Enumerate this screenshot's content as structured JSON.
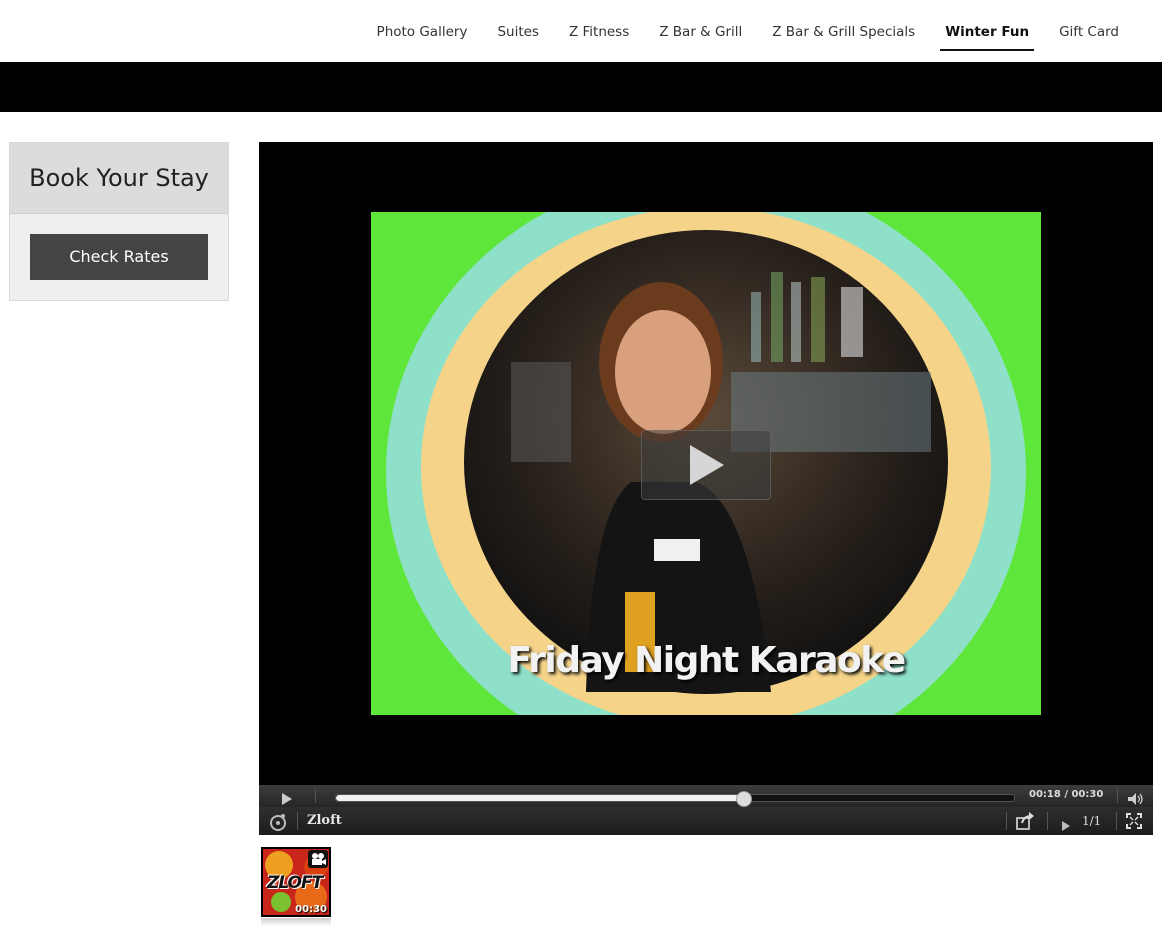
{
  "nav": {
    "items": [
      {
        "label": "Photo Gallery"
      },
      {
        "label": "Suites"
      },
      {
        "label": "Z Fitness"
      },
      {
        "label": "Z Bar & Grill"
      },
      {
        "label": "Z Bar & Grill Specials"
      },
      {
        "label": "Winter Fun"
      },
      {
        "label": "Gift Card"
      }
    ],
    "active_index": 5
  },
  "booking": {
    "title": "Book Your Stay",
    "button_label": "Check Rates"
  },
  "player": {
    "video_caption": "Friday Night Karaoke",
    "playlist_title": "Zloft",
    "time_text": "00:18 / 00:30",
    "progress_fraction": 0.6,
    "playlist_count": "1/1",
    "thumbnail_duration": "00:30",
    "thumbnail_logo": "ZLOFT"
  },
  "colors": {
    "nav_active_underline": "#111111",
    "band": "#000000",
    "button_bg": "#444444"
  }
}
